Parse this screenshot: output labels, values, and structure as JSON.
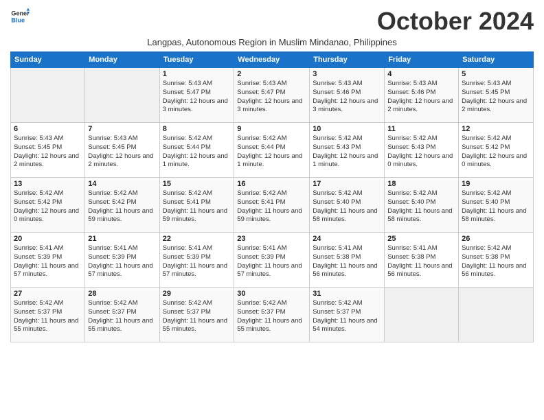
{
  "logo": {
    "line1": "General",
    "line2": "Blue",
    "icon_color": "#1a73c8"
  },
  "title": "October 2024",
  "subtitle": "Langpas, Autonomous Region in Muslim Mindanao, Philippines",
  "days_of_week": [
    "Sunday",
    "Monday",
    "Tuesday",
    "Wednesday",
    "Thursday",
    "Friday",
    "Saturday"
  ],
  "weeks": [
    [
      {
        "num": "",
        "info": ""
      },
      {
        "num": "",
        "info": ""
      },
      {
        "num": "1",
        "info": "Sunrise: 5:43 AM\nSunset: 5:47 PM\nDaylight: 12 hours and 3 minutes."
      },
      {
        "num": "2",
        "info": "Sunrise: 5:43 AM\nSunset: 5:47 PM\nDaylight: 12 hours and 3 minutes."
      },
      {
        "num": "3",
        "info": "Sunrise: 5:43 AM\nSunset: 5:46 PM\nDaylight: 12 hours and 3 minutes."
      },
      {
        "num": "4",
        "info": "Sunrise: 5:43 AM\nSunset: 5:46 PM\nDaylight: 12 hours and 2 minutes."
      },
      {
        "num": "5",
        "info": "Sunrise: 5:43 AM\nSunset: 5:45 PM\nDaylight: 12 hours and 2 minutes."
      }
    ],
    [
      {
        "num": "6",
        "info": "Sunrise: 5:43 AM\nSunset: 5:45 PM\nDaylight: 12 hours and 2 minutes."
      },
      {
        "num": "7",
        "info": "Sunrise: 5:43 AM\nSunset: 5:45 PM\nDaylight: 12 hours and 2 minutes."
      },
      {
        "num": "8",
        "info": "Sunrise: 5:42 AM\nSunset: 5:44 PM\nDaylight: 12 hours and 1 minute."
      },
      {
        "num": "9",
        "info": "Sunrise: 5:42 AM\nSunset: 5:44 PM\nDaylight: 12 hours and 1 minute."
      },
      {
        "num": "10",
        "info": "Sunrise: 5:42 AM\nSunset: 5:43 PM\nDaylight: 12 hours and 1 minute."
      },
      {
        "num": "11",
        "info": "Sunrise: 5:42 AM\nSunset: 5:43 PM\nDaylight: 12 hours and 0 minutes."
      },
      {
        "num": "12",
        "info": "Sunrise: 5:42 AM\nSunset: 5:42 PM\nDaylight: 12 hours and 0 minutes."
      }
    ],
    [
      {
        "num": "13",
        "info": "Sunrise: 5:42 AM\nSunset: 5:42 PM\nDaylight: 12 hours and 0 minutes."
      },
      {
        "num": "14",
        "info": "Sunrise: 5:42 AM\nSunset: 5:42 PM\nDaylight: 11 hours and 59 minutes."
      },
      {
        "num": "15",
        "info": "Sunrise: 5:42 AM\nSunset: 5:41 PM\nDaylight: 11 hours and 59 minutes."
      },
      {
        "num": "16",
        "info": "Sunrise: 5:42 AM\nSunset: 5:41 PM\nDaylight: 11 hours and 59 minutes."
      },
      {
        "num": "17",
        "info": "Sunrise: 5:42 AM\nSunset: 5:40 PM\nDaylight: 11 hours and 58 minutes."
      },
      {
        "num": "18",
        "info": "Sunrise: 5:42 AM\nSunset: 5:40 PM\nDaylight: 11 hours and 58 minutes."
      },
      {
        "num": "19",
        "info": "Sunrise: 5:42 AM\nSunset: 5:40 PM\nDaylight: 11 hours and 58 minutes."
      }
    ],
    [
      {
        "num": "20",
        "info": "Sunrise: 5:41 AM\nSunset: 5:39 PM\nDaylight: 11 hours and 57 minutes."
      },
      {
        "num": "21",
        "info": "Sunrise: 5:41 AM\nSunset: 5:39 PM\nDaylight: 11 hours and 57 minutes."
      },
      {
        "num": "22",
        "info": "Sunrise: 5:41 AM\nSunset: 5:39 PM\nDaylight: 11 hours and 57 minutes."
      },
      {
        "num": "23",
        "info": "Sunrise: 5:41 AM\nSunset: 5:39 PM\nDaylight: 11 hours and 57 minutes."
      },
      {
        "num": "24",
        "info": "Sunrise: 5:41 AM\nSunset: 5:38 PM\nDaylight: 11 hours and 56 minutes."
      },
      {
        "num": "25",
        "info": "Sunrise: 5:41 AM\nSunset: 5:38 PM\nDaylight: 11 hours and 56 minutes."
      },
      {
        "num": "26",
        "info": "Sunrise: 5:42 AM\nSunset: 5:38 PM\nDaylight: 11 hours and 56 minutes."
      }
    ],
    [
      {
        "num": "27",
        "info": "Sunrise: 5:42 AM\nSunset: 5:37 PM\nDaylight: 11 hours and 55 minutes."
      },
      {
        "num": "28",
        "info": "Sunrise: 5:42 AM\nSunset: 5:37 PM\nDaylight: 11 hours and 55 minutes."
      },
      {
        "num": "29",
        "info": "Sunrise: 5:42 AM\nSunset: 5:37 PM\nDaylight: 11 hours and 55 minutes."
      },
      {
        "num": "30",
        "info": "Sunrise: 5:42 AM\nSunset: 5:37 PM\nDaylight: 11 hours and 55 minutes."
      },
      {
        "num": "31",
        "info": "Sunrise: 5:42 AM\nSunset: 5:37 PM\nDaylight: 11 hours and 54 minutes."
      },
      {
        "num": "",
        "info": ""
      },
      {
        "num": "",
        "info": ""
      }
    ]
  ]
}
